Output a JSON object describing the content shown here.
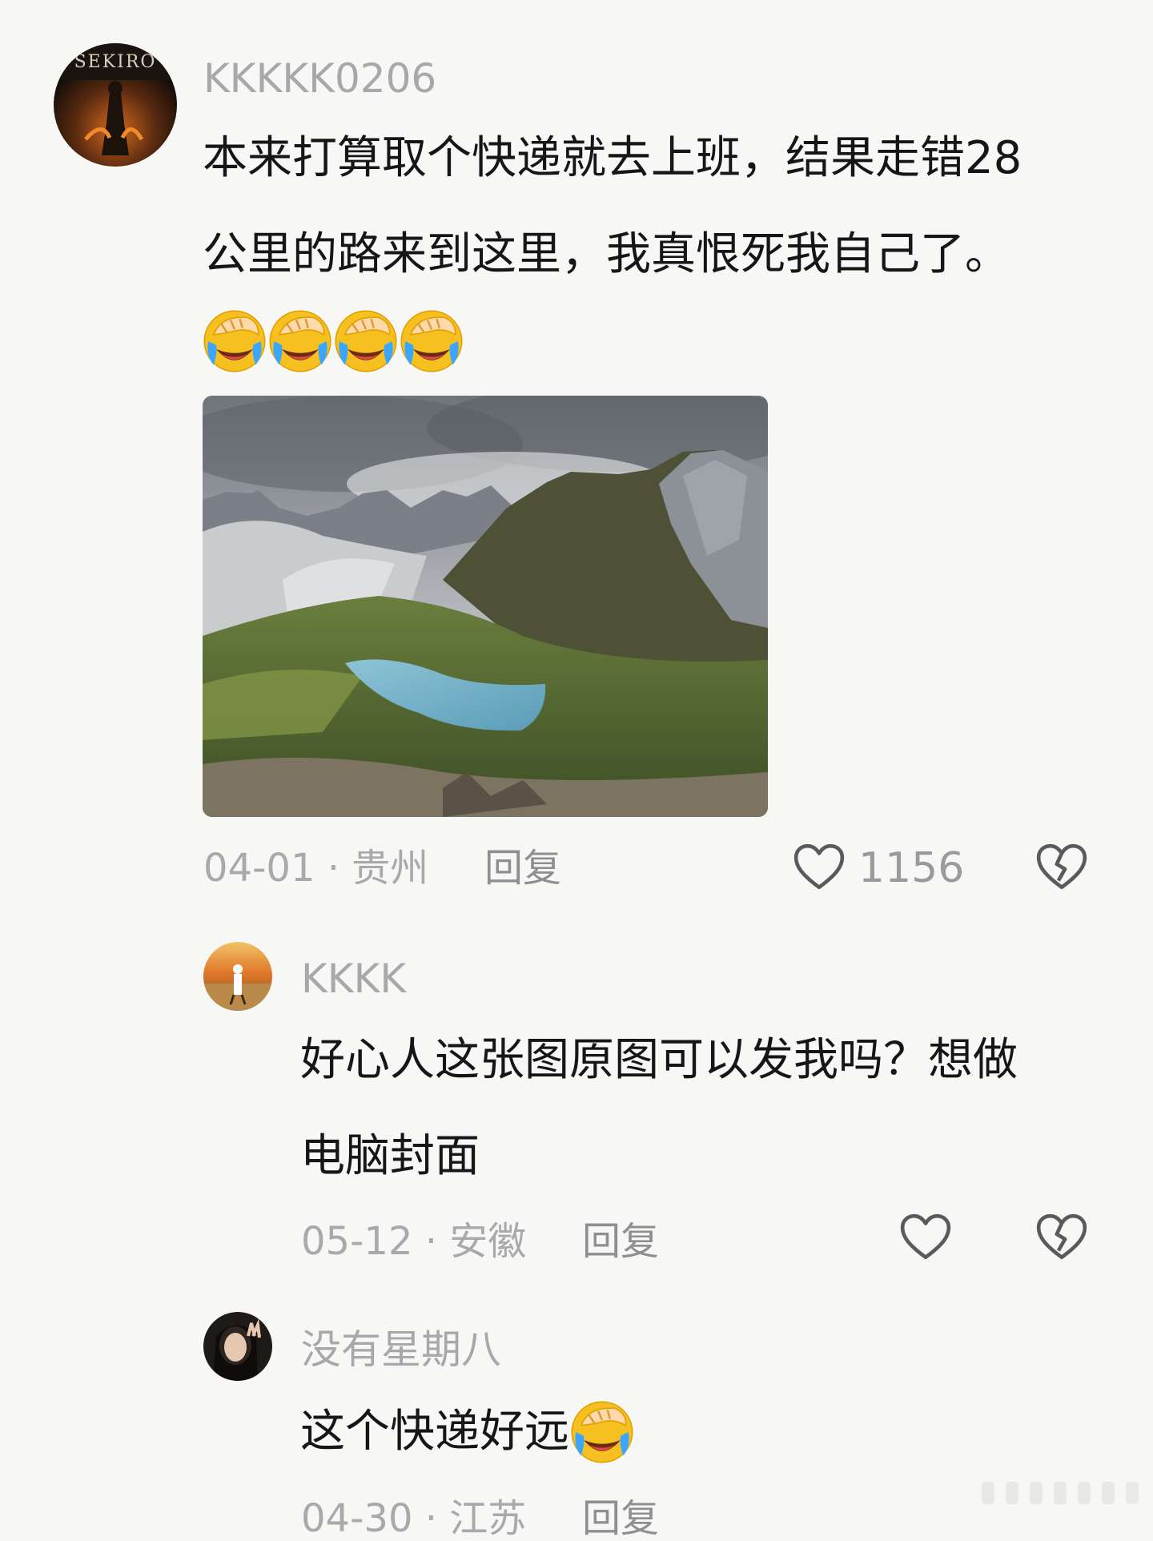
{
  "comments": [
    {
      "username": "KKKKK0206",
      "avatar_text": "SEKIRO",
      "text_line1": "本来打算取个快递就去上班，结果走错28",
      "text_line2": "公里的路来到这里，我真恨死我自己了。",
      "date_location": "04-01 · 贵州",
      "reply_label": "回复",
      "likes": "1156"
    },
    {
      "username": "KKKK",
      "text_line1": "好心人这张图原图可以发我吗？想做",
      "text_line2": "电脑封面",
      "date_location": "05-12 · 安徽",
      "reply_label": "回复"
    },
    {
      "username": "没有星期八",
      "text_line1": "这个快递好远",
      "date_location": "04-30 · 江苏",
      "reply_label": "回复"
    }
  ],
  "icons": {
    "like": "heart-icon",
    "dislike": "broken-heart-icon",
    "emoji": "facepalm-cry-emoji"
  },
  "colors": {
    "background": "#f7f7f5",
    "text": "#161616",
    "muted": "#a8a8a8"
  }
}
